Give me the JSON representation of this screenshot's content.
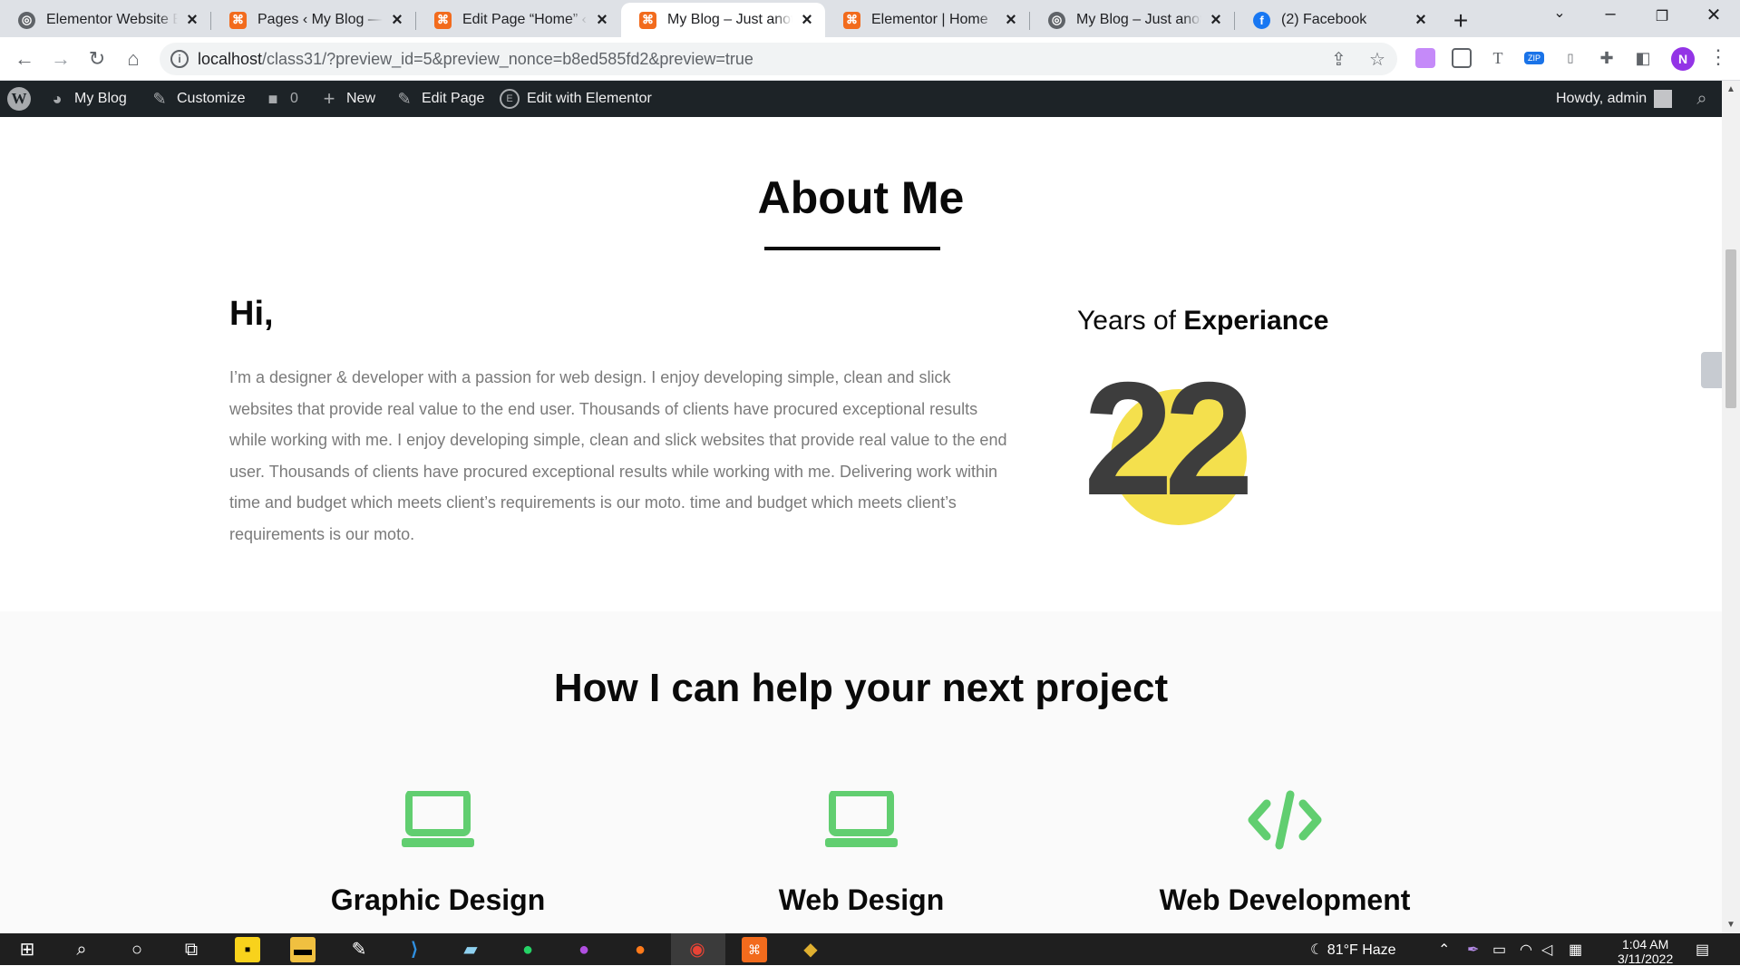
{
  "browser": {
    "tabs": [
      {
        "title": "Elementor Website Bu",
        "icon": "globe-icon"
      },
      {
        "title": "Pages ‹ My Blog — W",
        "icon": "wp-orange-icon"
      },
      {
        "title": "Edit Page “Home” ‹ M",
        "icon": "wp-orange-icon"
      },
      {
        "title": "My Blog – Just anothe",
        "icon": "wp-orange-icon",
        "active": true
      },
      {
        "title": "Elementor | Home",
        "icon": "wp-orange-icon"
      },
      {
        "title": "My Blog – Just anothe",
        "icon": "globe-icon"
      },
      {
        "title": "(2) Facebook",
        "icon": "facebook-icon"
      }
    ],
    "url_host": "localhost",
    "url_rest": "/class31/?preview_id=5&preview_nonce=b8ed585fd2&preview=true",
    "profile_initial": "N"
  },
  "adminbar": {
    "site": "My Blog",
    "customize": "Customize",
    "comments": "0",
    "new": "New",
    "edit_page": "Edit Page",
    "edit_elementor": "Edit with Elementor",
    "howdy": "Howdy, admin"
  },
  "about": {
    "title": "About Me",
    "greeting": "Hi,",
    "bio": "I’m a designer & developer with a passion for web design. I enjoy developing simple, clean and slick websites that provide real value to the end user. Thousands of clients have procured exceptional results while working with me. I enjoy developing simple, clean and slick websites that provide real value to the end user. Thousands of clients have procured exceptional results while working with me. Delivering work within time and budget which meets client’s requirements is our moto. time and budget which meets client’s requirements is our moto.",
    "years_prefix": "Years of ",
    "years_bold": "Experiance",
    "years_value": "22",
    "accent_color": "#f4e04d"
  },
  "help": {
    "title": "How I can help your next project",
    "services": [
      {
        "title": "Graphic Design",
        "icon": "laptop-icon"
      },
      {
        "title": "Web Design",
        "icon": "laptop-icon"
      },
      {
        "title": "Web Development",
        "icon": "code-icon"
      }
    ],
    "icon_color": "#61ce70"
  },
  "taskbar": {
    "weather": "81°F  Haze",
    "time": "1:04 AM",
    "date": "3/11/2022"
  }
}
